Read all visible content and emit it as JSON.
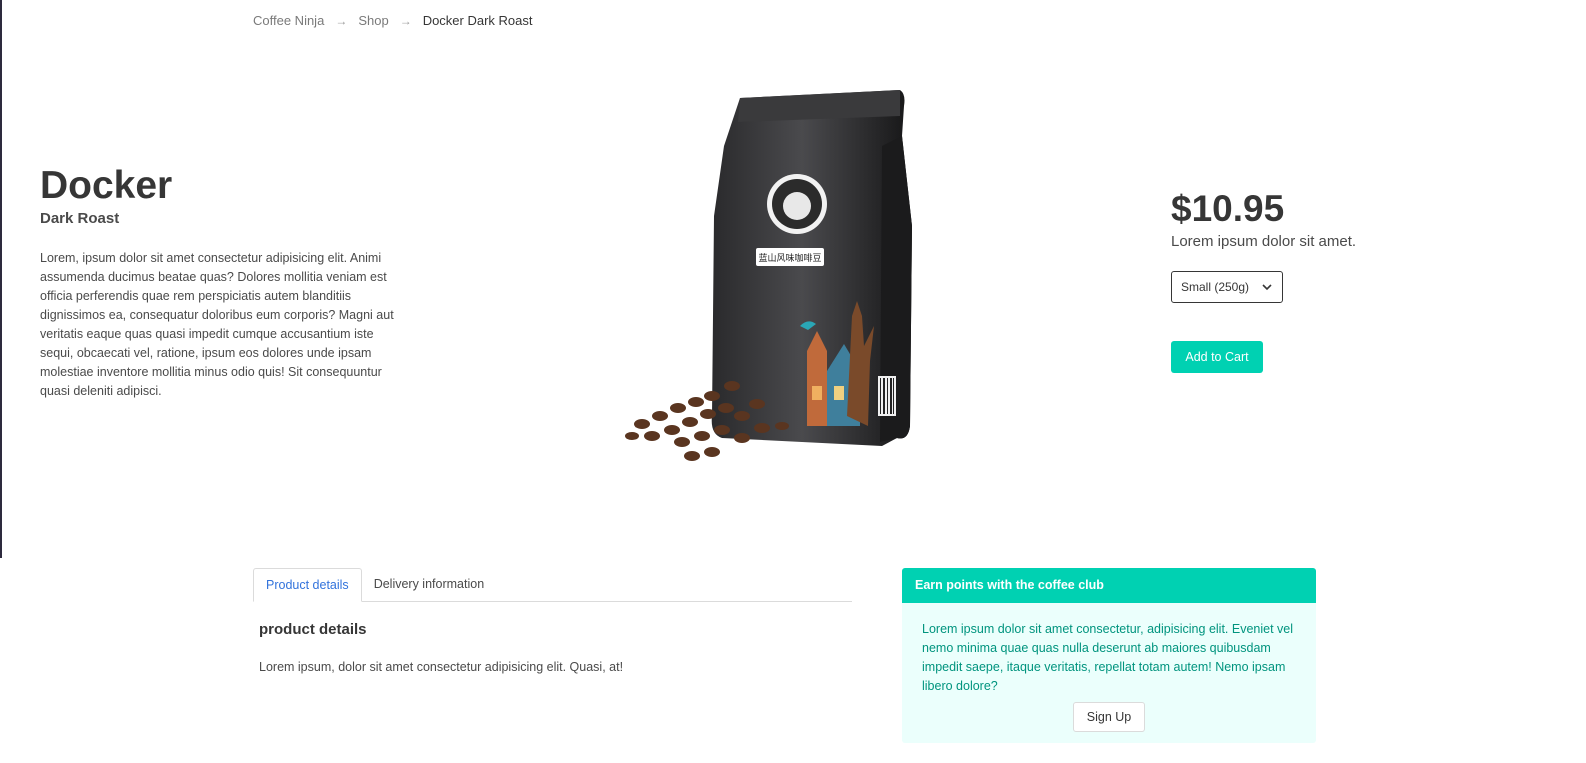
{
  "breadcrumb": {
    "items": [
      "Coffee Ninja",
      "Shop",
      "Docker Dark Roast"
    ],
    "separator": "→"
  },
  "product": {
    "title": "Docker",
    "subtitle": "Dark Roast",
    "description": "Lorem, ipsum dolor sit amet consectetur adipisicing elit. Animi assumenda ducimus beatae quas? Dolores mollitia veniam est officia perferendis quae rem perspiciatis autem blanditiis dignissimos ea, consequatur doloribus eum corporis? Magni aut veritatis eaque quas quasi impedit cumque accusantium iste sequi, obcaecati vel, ratione, ipsum eos dolores unde ipsam molestiae inventore mollitia minus odio quis! Sit consequuntur quasi deleniti adipisci.",
    "bag_label": "蓝山风味咖啡豆"
  },
  "purchase": {
    "price": "$10.95",
    "note": "Lorem ipsum dolor sit amet.",
    "size_selected": "Small (250g)",
    "add_to_cart": "Add to Cart"
  },
  "tabs": {
    "items": [
      "Product details",
      "Delivery information"
    ],
    "active": "Product details",
    "content_heading": "product details",
    "content_text": "Lorem ipsum, dolor sit amet consectetur adipisicing elit. Quasi, at!"
  },
  "club": {
    "header": "Earn points with the coffee club",
    "body": "Lorem ipsum dolor sit amet consectetur, adipisicing elit. Eveniet vel nemo minima quae quas nulla deserunt ab maiores quibusdam impedit saepe, itaque veritatis, repellat totam autem! Nemo ipsam libero dolore?",
    "signup": "Sign Up"
  },
  "colors": {
    "accent": "#00d1b2",
    "link": "#3273dc",
    "club_bg": "#ebfffc",
    "club_text": "#00947e"
  }
}
